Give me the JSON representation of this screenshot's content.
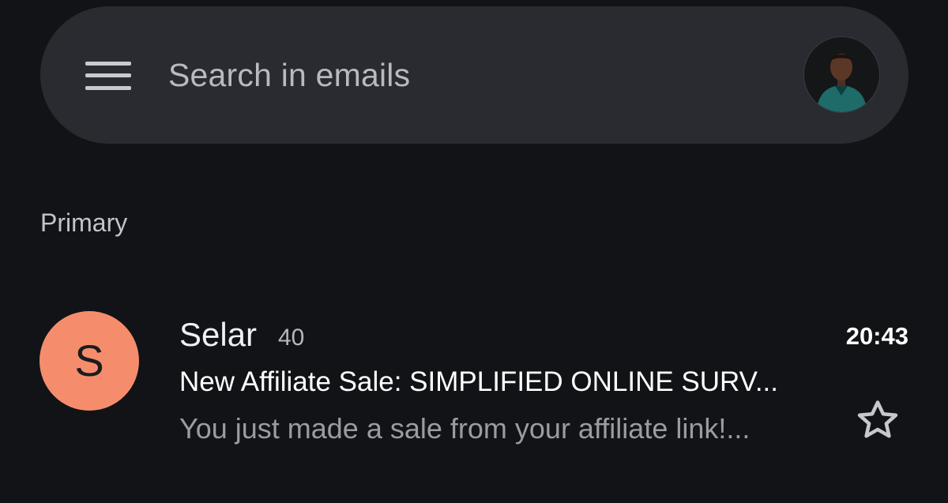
{
  "search": {
    "placeholder": "Search in emails"
  },
  "section": {
    "label": "Primary"
  },
  "email": {
    "sender_initial": "S",
    "sender": "Selar",
    "count": "40",
    "time": "20:43",
    "subject": "New Affiliate Sale: SIMPLIFIED ONLINE SURV...",
    "preview": "You just made a sale from your affiliate link!..."
  },
  "colors": {
    "background": "#121316",
    "search_bar": "#2a2b30",
    "avatar_accent": "#f58d6c"
  },
  "icons": {
    "menu": "hamburger-menu-icon",
    "star": "star-outline-icon"
  }
}
